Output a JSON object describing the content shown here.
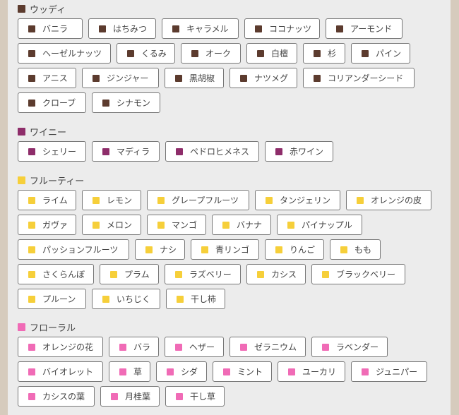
{
  "sections": [
    {
      "title": "ウッディ",
      "color": "#5c3b2e",
      "rows": [
        [
          "バニラ",
          "はちみつ",
          "キャラメル",
          "ココナッツ",
          "アーモンド"
        ],
        [
          "ヘーゼルナッツ",
          "くるみ",
          "オーク",
          "白檀",
          "杉",
          "パイン"
        ],
        [
          "アニス",
          "ジンジャー",
          "黒胡椒",
          "ナツメグ",
          "コリアンダーシード"
        ],
        [
          "クローブ",
          "シナモン"
        ]
      ]
    },
    {
      "title": "ワイニー",
      "color": "#8e2d6a",
      "rows": [
        [
          "シェリー",
          "マディラ",
          "ペドロヒメネス",
          "赤ワイン"
        ]
      ]
    },
    {
      "title": "フルーティー",
      "color": "#f6cf3a",
      "rows": [
        [
          "ライム",
          "レモン",
          "グレープフルーツ",
          "タンジェリン",
          "オレンジの皮"
        ],
        [
          "ガヴァ",
          "メロン",
          "マンゴ",
          "バナナ",
          "パイナップル"
        ],
        [
          "パッションフルーツ",
          "ナシ",
          "青リンゴ",
          "りんご",
          "もも"
        ],
        [
          "さくらんぼ",
          "プラム",
          "ラズベリー",
          "カシス",
          "ブラックベリー"
        ],
        [
          "プルーン",
          "いちじく",
          "干し柿"
        ]
      ]
    },
    {
      "title": "フローラル",
      "color": "#f06bb6",
      "rows": [
        [
          "オレンジの花",
          "バラ",
          "ヘザー",
          "ゼラニウム",
          "ラベンダー"
        ],
        [
          "バイオレット",
          "草",
          "シダ",
          "ミント",
          "ユーカリ",
          "ジュニパー"
        ],
        [
          "カシスの葉",
          "月桂葉",
          "干し草"
        ]
      ]
    }
  ]
}
